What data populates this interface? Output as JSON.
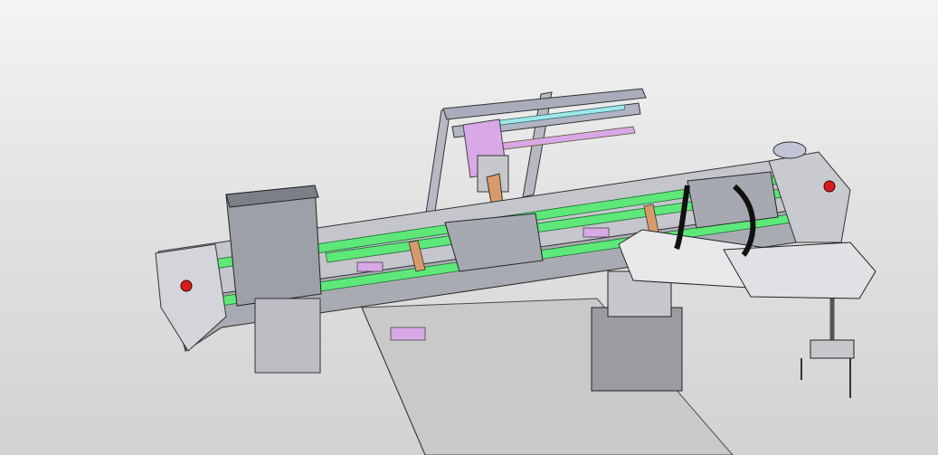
{
  "viewport": {
    "background_top": "#f4f4f4",
    "background_bottom": "#d2d2d2"
  },
  "model": {
    "colors": {
      "conveyor_belt": "#5ee87a",
      "frame_metal": "#b9bcc4",
      "pink_blocks": "#d9a8e6",
      "red_fixture": "#e02020",
      "orange_bracket": "#d89a6a",
      "robot_arm": "#e8e8ea",
      "table_plate": "#c8c8c8",
      "gantry_rail": "#a9aebe",
      "light_tube": "#9fe8ea"
    }
  }
}
